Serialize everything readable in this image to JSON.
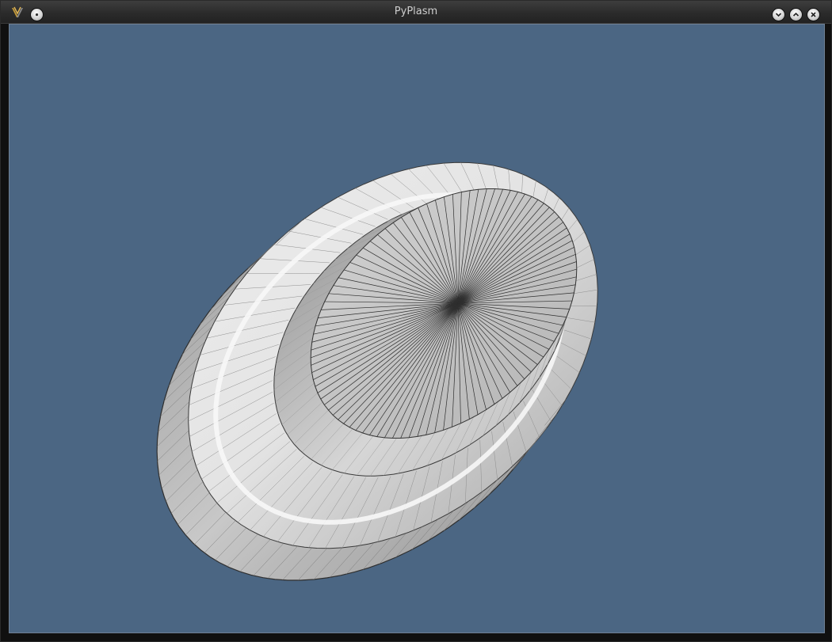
{
  "window": {
    "title": "PyPlasm",
    "buttons": {
      "menu": "window-menu",
      "minimize": "minimize",
      "maximize": "maximize",
      "close": "close"
    }
  },
  "viewport": {
    "background_color": "#4b6683",
    "model_color": "#cfcfcf",
    "edge_color": "#2f2f2f"
  }
}
